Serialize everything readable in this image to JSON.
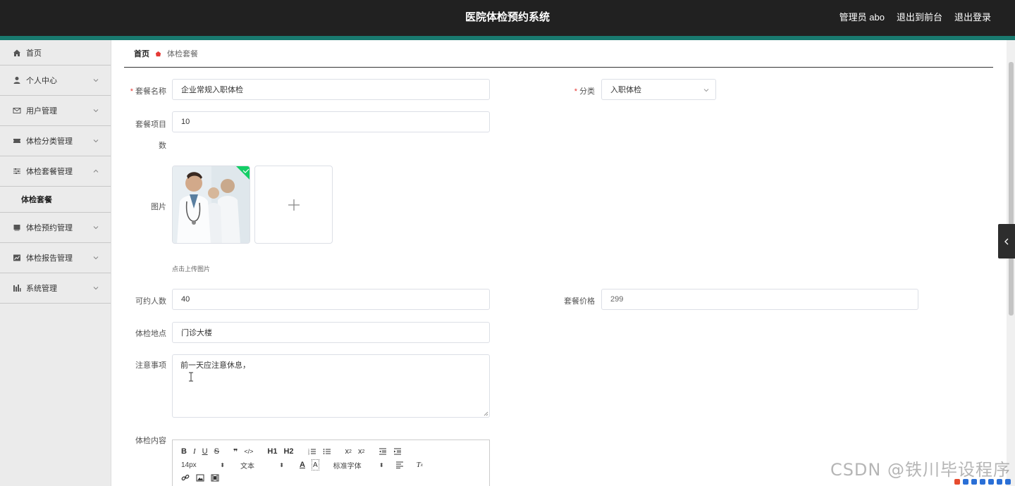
{
  "header": {
    "title": "医院体检预约系统",
    "admin": "管理员 abo",
    "front": "退出到前台",
    "logout": "退出登录"
  },
  "sidebar": {
    "items": [
      {
        "label": "首页"
      },
      {
        "label": "个人中心"
      },
      {
        "label": "用户管理"
      },
      {
        "label": "体检分类管理"
      },
      {
        "label": "体检套餐管理"
      },
      {
        "label": "体检套餐"
      },
      {
        "label": "体检预约管理"
      },
      {
        "label": "体检报告管理"
      },
      {
        "label": "系统管理"
      }
    ]
  },
  "breadcrumb": {
    "home": "首页",
    "current": "体检套餐"
  },
  "form": {
    "package_name_label": "套餐名称",
    "package_name_value": "企业常规入职体检",
    "category_label": "分类",
    "category_value": "入职体检",
    "items_count_label_1": "套餐项目",
    "items_count_label_2": "数",
    "items_count_value": "10",
    "image_label": "图片",
    "upload_tip": "点击上传图片",
    "capacity_label": "可约人数",
    "capacity_value": "40",
    "price_label": "套餐价格",
    "price_value": "299",
    "location_label": "体检地点",
    "location_value": "门诊大楼",
    "notes_label": "注意事项",
    "notes_value": "前一天应注意休息，",
    "content_label": "体检内容"
  },
  "editor": {
    "font_size": "14px",
    "text_type": "文本",
    "font_family": "标准字体",
    "h1": "H1",
    "h2": "H2"
  },
  "watermark": "CSDN @铁川毕设程序",
  "colors": {
    "header_bg": "#212121",
    "accent": "#197a6f",
    "required": "#e53935"
  }
}
